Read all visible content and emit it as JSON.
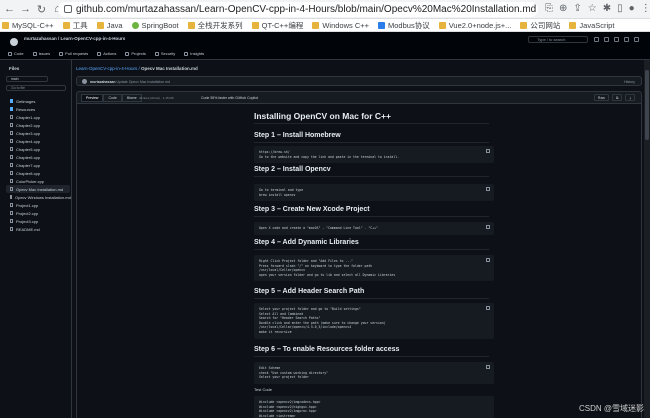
{
  "browser": {
    "url": "github.com/murtazahassan/Learn-OpenCV-cpp-in-4-Hours/blob/main/Opecv%20Mac%20Installation.md",
    "bookmarks": [
      "MySQL-C++",
      "工具",
      "Java",
      "SpringBoot",
      "全栈开发系列",
      "QT-C++编程",
      "Windows C++",
      "Modbus协议",
      "Vue2.0+node.js+...",
      "公司网站",
      "JavaScript"
    ]
  },
  "github": {
    "repo_path": "murtazahassan / Learn-OpenCV-cpp-in-4-Hours",
    "search_placeholder": "Type / to search",
    "tabs": [
      "Code",
      "Issues",
      "Pull requests",
      "Actions",
      "Projects",
      "Security",
      "Insights"
    ]
  },
  "sidebar": {
    "title": "Files",
    "branch": "main",
    "find_placeholder": "Go to file",
    "items": [
      {
        "label": "Getimages",
        "type": "folder"
      },
      {
        "label": "Resources",
        "type": "folder"
      },
      {
        "label": "Chapter1.cpp",
        "type": "file"
      },
      {
        "label": "Chapter2.cpp",
        "type": "file"
      },
      {
        "label": "Chapter3.cpp",
        "type": "file"
      },
      {
        "label": "Chapter4.cpp",
        "type": "file"
      },
      {
        "label": "Chapter5.cpp",
        "type": "file"
      },
      {
        "label": "Chapter6.cpp",
        "type": "file"
      },
      {
        "label": "Chapter7.cpp",
        "type": "file"
      },
      {
        "label": "Chapter8.cpp",
        "type": "file"
      },
      {
        "label": "ColorPicker.cpp",
        "type": "file"
      },
      {
        "label": "Opecv Mac Installation.md",
        "type": "file",
        "active": true
      },
      {
        "label": "Opecv Windows Installation.md",
        "type": "file"
      },
      {
        "label": "Project1.cpp",
        "type": "file"
      },
      {
        "label": "Project2.cpp",
        "type": "file"
      },
      {
        "label": "Project3.cpp",
        "type": "file"
      },
      {
        "label": "README.md",
        "type": "file"
      }
    ]
  },
  "main": {
    "breadcrumb_repo": "Learn-OpenCV-cpp-in-4-Hours",
    "breadcrumb_file": "Opecv Mac Installation.md",
    "commit_author": "murtazahassan",
    "commit_msg": "Update Opecv Mac Installation.md",
    "commit_meta": "History",
    "view_tabs": [
      "Preview",
      "Code",
      "Blame"
    ],
    "file_info": "46 lines (34 loc) · 1.15 KB",
    "outline": "Code 55% faster with GitHub Copilot",
    "raw_buttons": [
      "Raw",
      "⧉",
      "⤓"
    ]
  },
  "doc": {
    "title": "Installing OpenCV on Mac for C++",
    "sections": [
      {
        "heading": "Step 1 – Install Homebrew",
        "lines": [
          "https://brew.sh/",
          "Go to the website and copy the link and paste in the terminal to install."
        ]
      },
      {
        "heading": "Step 2 – Install Opencv",
        "lines": [
          "Go to terminal and type",
          "brew install opencv"
        ]
      },
      {
        "heading": "Step 3 – Create New Xcode Project",
        "lines": [
          "Open X code and create a \"macOS\" - \"Command Line Tool\" - \"C++\""
        ]
      },
      {
        "heading": "Step 4 – Add Dynamic Libraries",
        "lines": [
          "Right Click Project folder and \"Add Files to ...\"",
          "Press forward slash \"/\" on keyboard to type the folder path",
          "/usr/local/Cellar/opencv",
          "open your version folder and go to lib and select all Dynamic Libraries"
        ]
      },
      {
        "heading": "Step 5 – Add Header Search Path",
        "lines": [
          "Select your project folder and go to \"Build settings\"",
          "Select All and Combined",
          "Search for \"Header Search Paths\"",
          "Double click and enter the path (make sure to change your version)",
          "/usr/local/Cellar/opencv/4.5.0_5/include/opencv4",
          "make it recursive"
        ]
      },
      {
        "heading": "Step 6 – To enable Resources folder access",
        "lines": [
          "Edit Scheme",
          "check \"Use custom working directory\"",
          "Select your project folder"
        ]
      }
    ],
    "test_code_label": "Test Code",
    "test_code_lines": [
      "#include <opencv2/imgcodecs.hpp>",
      "#include <opencv2/highgui.hpp>",
      "#include <opencv2/imgproc.hpp>",
      "#include <iostream>"
    ]
  },
  "watermark": "CSDN @雪域迷影"
}
